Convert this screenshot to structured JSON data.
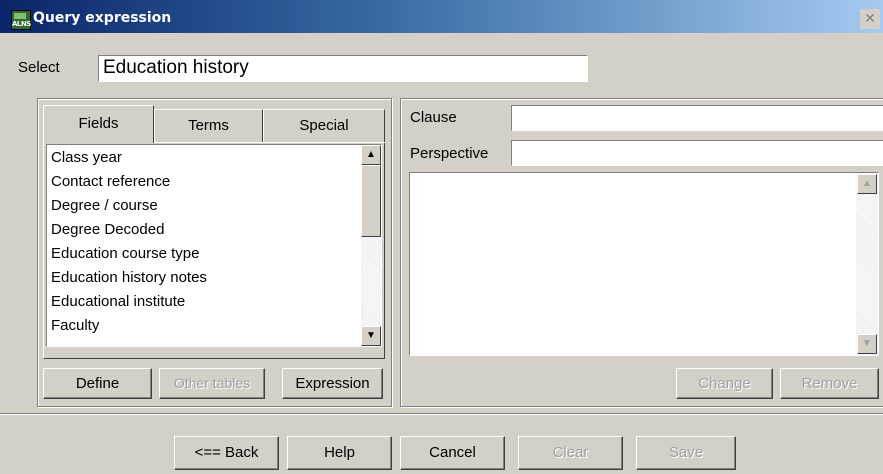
{
  "window": {
    "title": "Query expression",
    "icon_text": "ALNS",
    "close_glyph": "✕"
  },
  "select": {
    "label": "Select",
    "value": "Education history"
  },
  "tabs": [
    {
      "label": "Fields",
      "selected": true
    },
    {
      "label": "Terms",
      "selected": false
    },
    {
      "label": "Special",
      "selected": false
    }
  ],
  "fields_list": [
    "Class year",
    "Contact reference",
    "Degree / course",
    "Degree Decoded",
    "Education course type",
    "Education history notes",
    "Educational institute",
    "Faculty"
  ],
  "left_buttons": {
    "define": "Define",
    "other_tables": "Other tables",
    "expression": "Expression"
  },
  "clause": {
    "label": "Clause",
    "value": ""
  },
  "perspective": {
    "label": "Perspective",
    "value": ""
  },
  "right_buttons": {
    "change": "Change",
    "remove": "Remove"
  },
  "bottom_buttons": {
    "back": "<== Back",
    "help": "Help",
    "cancel": "Cancel",
    "clear": "Clear",
    "save": "Save"
  }
}
